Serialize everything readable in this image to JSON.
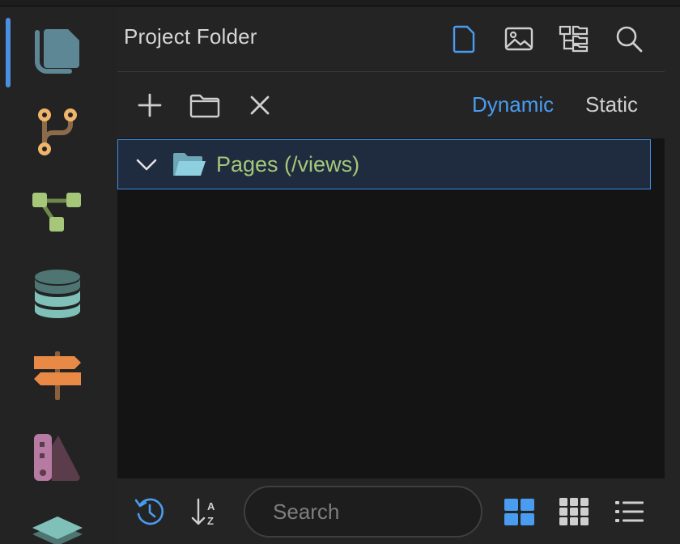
{
  "header": {
    "title": "Project Folder",
    "icons": [
      "file-icon",
      "image-icon",
      "tree-folder-icon",
      "search-icon"
    ],
    "active_icon": "file-icon"
  },
  "toolbar": {
    "icons": [
      "plus-icon",
      "folder-icon",
      "close-icon"
    ],
    "modes": {
      "dynamic_label": "Dynamic",
      "static_label": "Static",
      "selected": "Dynamic"
    }
  },
  "tree": {
    "items": [
      {
        "label": "Pages (/views)",
        "expanded": true,
        "selected": true,
        "icon": "folder-open-icon"
      }
    ]
  },
  "sidebar": {
    "items": [
      {
        "name": "pages",
        "icon": "pages-icon",
        "active": true
      },
      {
        "name": "branches",
        "icon": "git-branch-icon"
      },
      {
        "name": "flows",
        "icon": "flow-icon"
      },
      {
        "name": "database",
        "icon": "database-icon"
      },
      {
        "name": "routes",
        "icon": "signpost-icon"
      },
      {
        "name": "styles",
        "icon": "swatch-icon"
      },
      {
        "name": "layers",
        "icon": "layers-icon"
      }
    ]
  },
  "footer": {
    "search": {
      "placeholder": "Search",
      "value": ""
    },
    "icons": [
      "history-icon",
      "sort-az-icon",
      "grid-large-icon",
      "grid-small-icon",
      "list-icon"
    ],
    "active_view": "grid-large-icon"
  },
  "colors": {
    "accent": "#4a9cf1",
    "tree_label": "#a6c779",
    "selection_bg": "#1f2c3f"
  }
}
